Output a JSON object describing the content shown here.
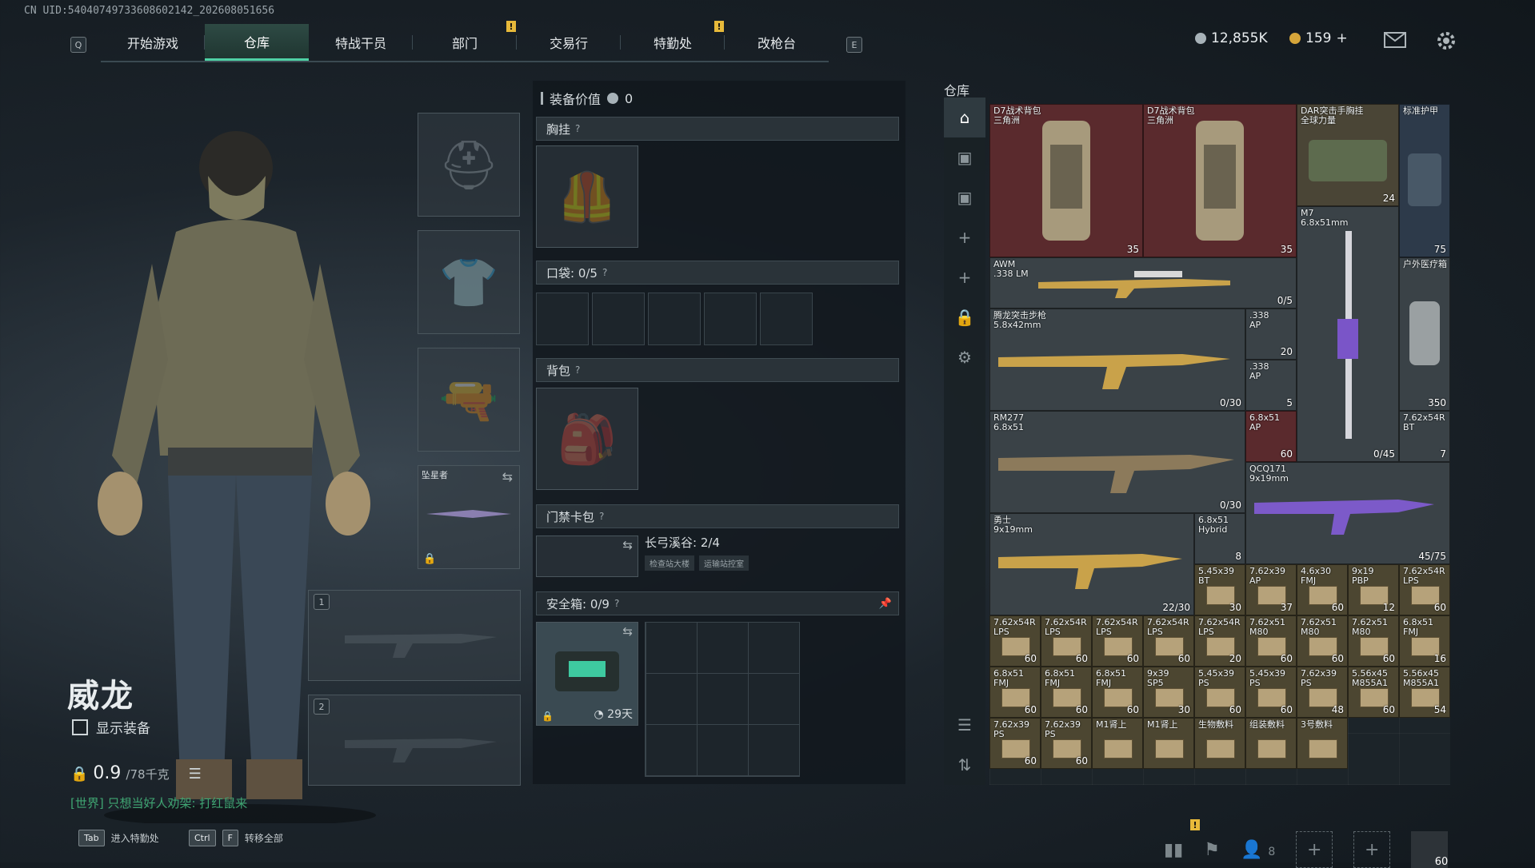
{
  "uid": "CN UID:540407497336086021­42_202608051656",
  "nav": {
    "q_key": "Q",
    "e_key": "E",
    "tabs": [
      "开始游戏",
      "仓库",
      "特战干员",
      "部门",
      "交易行",
      "特勤处",
      "改枪台"
    ],
    "active_tab": "仓库"
  },
  "currency": {
    "silver": "12,855K",
    "gold": "159",
    "plus": "+"
  },
  "character": {
    "name": "威龙",
    "show_equip": "显示装备",
    "weight_value": "0.9",
    "weight_max": "/78千克",
    "chat": "[世界] 只想当好人劝架: 打红鼠来"
  },
  "bottom_hints": [
    {
      "keys": [
        "Tab"
      ],
      "label": "进入特勤处"
    },
    {
      "keys": [
        "Ctrl",
        "F"
      ],
      "label": "转移全部"
    }
  ],
  "slots": {
    "melee_name": "坠星者",
    "weapon1": "1",
    "weapon2": "2"
  },
  "equipment": {
    "value_label": "装备价值",
    "value": "0",
    "chest": "胸挂",
    "pocket": "口袋: 0/5",
    "backpack": "背包",
    "keycard": "门禁卡包",
    "keycard_map": "长弓溪谷: 2/4",
    "keycard_tags": [
      "检查站大楼",
      "运输站控室"
    ],
    "safe": "安全箱: 0/9",
    "safe_days": "29天",
    "help": "?"
  },
  "warehouse": {
    "title": "仓库",
    "items": [
      {
        "name": "D7战术背包\n三角洲",
        "count": "35",
        "color": "red"
      },
      {
        "name": "D7战术背包\n三角洲",
        "count": "35",
        "color": "red"
      },
      {
        "name": "DAR突击手胸挂\n全球力量",
        "count": "24",
        "color": "gray"
      },
      {
        "name": "标准护甲",
        "count": "75",
        "color": "blue"
      },
      {
        "name": "AWM\n.338 LM",
        "count": "0/5",
        "color": "gray"
      },
      {
        "name": "M7\n6.8x51mm",
        "count": "0/45",
        "color": "gray"
      },
      {
        "name": "户外医疗箱",
        "count": "350",
        "color": "gray"
      },
      {
        "name": "腾龙突击步枪\n5.8x42mm",
        "count": "0/30",
        "color": "gray"
      },
      {
        "name": ".338\nAP",
        "count": "20",
        "color": "gray"
      },
      {
        "name": ".338\nAP",
        "count": "5",
        "color": "gray"
      },
      {
        "name": "RM277\n6.8x51",
        "count": "0/30",
        "color": "gray"
      },
      {
        "name": "6.8x51\nAP",
        "count": "60",
        "color": "red"
      },
      {
        "name": "7.62x54R\nBT",
        "count": "7",
        "color": "gray"
      },
      {
        "name": "QCQ171\n9x19mm",
        "count": "45/75",
        "color": "gray"
      },
      {
        "name": "勇士\n9x19mm",
        "count": "22/30",
        "color": "gray"
      },
      {
        "name": "6.8x51\nHybrid",
        "count": "8",
        "color": "gray"
      }
    ],
    "ammo": [
      {
        "name": "5.45x39\nBT",
        "count": "30"
      },
      {
        "name": "7.62x39\nAP",
        "count": "37"
      },
      {
        "name": "4.6x30\nFMJ",
        "count": "60"
      },
      {
        "name": "9x19\nPBP",
        "count": "12"
      },
      {
        "name": "7.62x54R\nLPS",
        "count": "60"
      },
      {
        "name": "7.62x54R\nLPS",
        "count": "60"
      },
      {
        "name": "7.62x54R\nLPS",
        "count": "60"
      },
      {
        "name": "7.62x54R\nLPS",
        "count": "60"
      },
      {
        "name": "7.62x54R\nLPS",
        "count": "60"
      },
      {
        "name": "7.62x54R\nLPS",
        "count": "20"
      },
      {
        "name": "7.62x51\nM80",
        "count": "60"
      },
      {
        "name": "7.62x51\nM80",
        "count": "60"
      },
      {
        "name": "7.62x51\nM80",
        "count": "60"
      },
      {
        "name": "6.8x51\nFMJ",
        "count": "16"
      },
      {
        "name": "6.8x51\nFMJ",
        "count": "60"
      },
      {
        "name": "6.8x51\nFMJ",
        "count": "60"
      },
      {
        "name": "6.8x51\nFMJ",
        "count": "60"
      },
      {
        "name": "9x39\nSP5",
        "count": "30"
      },
      {
        "name": "5.45x39\nPS",
        "count": "60"
      },
      {
        "name": "5.45x39\nPS",
        "count": "60"
      },
      {
        "name": "7.62x39\nPS",
        "count": "48"
      },
      {
        "name": "5.56x45\nM855A1",
        "count": "60"
      },
      {
        "name": "5.56x45\nM855A1",
        "count": "54"
      },
      {
        "name": "7.62x39\nPS",
        "count": "60"
      },
      {
        "name": "7.62x39\nPS",
        "count": "60"
      },
      {
        "name": "M1肾上",
        "count": ""
      },
      {
        "name": "M1肾上",
        "count": ""
      },
      {
        "name": "生物敷料",
        "count": ""
      },
      {
        "name": "组装敷料",
        "count": ""
      },
      {
        "name": "3号敷料",
        "count": ""
      }
    ]
  },
  "footer": {
    "party": "8",
    "level": "60"
  }
}
